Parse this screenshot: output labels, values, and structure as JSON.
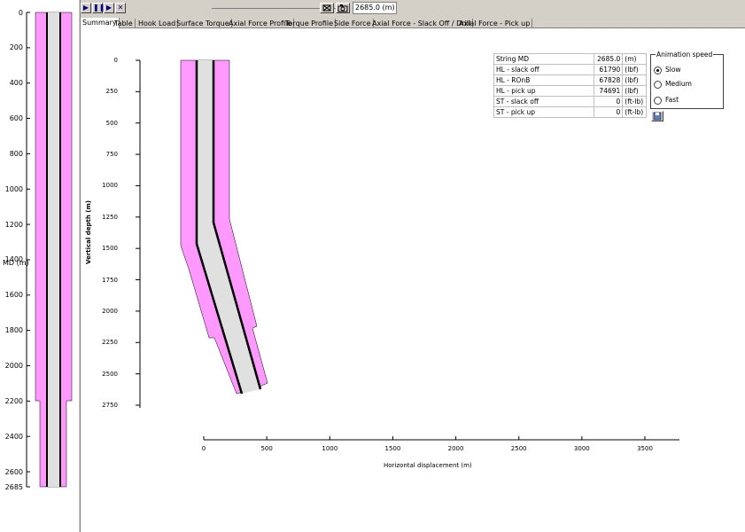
{
  "toolbar": {
    "play_icon": "play-icon",
    "pause_icon": "pause-icon",
    "step_icon": "step-icon",
    "stop_icon": "stop-icon",
    "md_value": "2685.0 (m)",
    "icon_a": "export-icon",
    "icon_b": "camera-icon"
  },
  "tabs": [
    {
      "label": "Summary"
    },
    {
      "label": "Table"
    },
    {
      "label": "Hook Load"
    },
    {
      "label": "Surface Torque"
    },
    {
      "label": "Axial Force Profile"
    },
    {
      "label": "Torque Profile"
    },
    {
      "label": "Side Force"
    },
    {
      "label": "Axial Force - Slack Off / Drill"
    },
    {
      "label": "Axial Force - Pick up"
    }
  ],
  "md_axis": {
    "label": "MD (m)",
    "ticks": [
      "0",
      "200",
      "400",
      "600",
      "800",
      "1000",
      "1200",
      "1400",
      "1600",
      "1800",
      "2000",
      "2200",
      "2400",
      "2600",
      "2685"
    ]
  },
  "plot": {
    "ylabel": "Vertical depth (m)",
    "xlabel": "Horizontal displacement (m)",
    "y_ticks": [
      "0",
      "250",
      "500",
      "750",
      "1000",
      "1250",
      "1500",
      "1750",
      "2000",
      "2250",
      "2500",
      "2750"
    ],
    "x_ticks": [
      "0",
      "500",
      "1000",
      "1500",
      "2000",
      "2500",
      "3000",
      "3500"
    ]
  },
  "results": [
    {
      "label": "String MD",
      "value": "2685.0",
      "unit": "(m)"
    },
    {
      "label": "HL - slack off",
      "value": "61790",
      "unit": "(lbf)"
    },
    {
      "label": "HL - ROnB",
      "value": "67828",
      "unit": "(lbf)"
    },
    {
      "label": "HL - pick up",
      "value": "74691",
      "unit": "(lbf)"
    },
    {
      "label": "ST - slack off",
      "value": "0",
      "unit": "(ft-lb)"
    },
    {
      "label": "ST - pick up",
      "value": "0",
      "unit": "(ft-lb)"
    }
  ],
  "speed": {
    "legend": "Animation speed",
    "options": [
      {
        "label": "Slow",
        "selected": true
      },
      {
        "label": "Medium",
        "selected": false
      },
      {
        "label": "Fast",
        "selected": false
      }
    ]
  },
  "save_icon": "save-icon",
  "colors": {
    "hole": "#ff99ff",
    "pipe": "#e0e0e0",
    "pipe_wall": "#000000",
    "chrome": "#d4d0c8"
  }
}
